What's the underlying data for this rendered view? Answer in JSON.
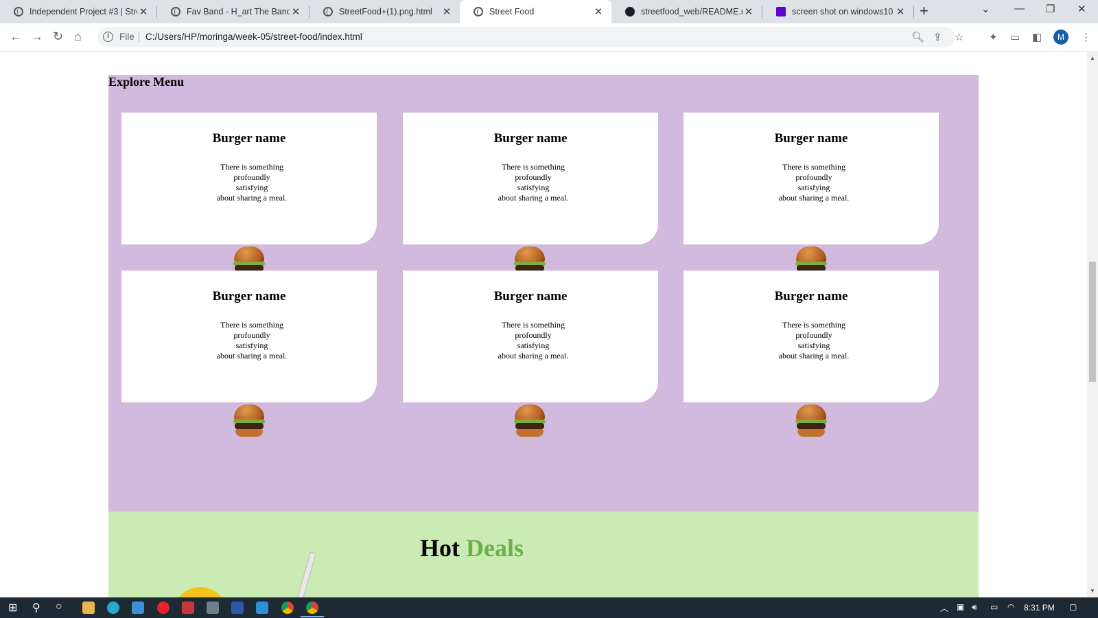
{
  "browser": {
    "tabs": [
      {
        "title": "Independent Project #3 | Stree",
        "active": false
      },
      {
        "title": "Fav Band - H_art The Band",
        "active": false
      },
      {
        "title": "StreetFood+(1).png.html",
        "active": false
      },
      {
        "title": "Street Food",
        "active": true
      },
      {
        "title": "streetfood_web/README.md",
        "active": false
      },
      {
        "title": "screen shot on windows10 - Y",
        "active": false
      }
    ],
    "new_tab_label": "+",
    "address": {
      "scheme_label": "File",
      "url": "C:/Users/HP/moringa/week-05/street-food/index.html"
    },
    "profile_initial": "M"
  },
  "page": {
    "menu": {
      "heading": "Explore Menu",
      "cards": [
        {
          "name": "Burger name",
          "description": "There is something\nprofoundly\nsatisfying\nabout sharing a meal."
        },
        {
          "name": "Burger name",
          "description": "There is something\nprofoundly\nsatisfying\nabout sharing a meal."
        },
        {
          "name": "Burger name",
          "description": "There is something\nprofoundly\nsatisfying\nabout sharing a meal."
        },
        {
          "name": "Burger name",
          "description": "There is something\nprofoundly\nsatisfying\nabout sharing a meal."
        },
        {
          "name": "Burger name",
          "description": "There is something\nprofoundly\nsatisfying\nabout sharing a meal."
        },
        {
          "name": "Burger name",
          "description": "There is something\nprofoundly\nsatisfying\nabout sharing a meal."
        }
      ]
    },
    "deals": {
      "title_main": "Hot",
      "title_accent": "Deals"
    }
  },
  "taskbar": {
    "clock": "8:31 PM"
  },
  "colors": {
    "menu_background": "#d2bade",
    "deals_background": "#caebb3",
    "deals_accent": "#6bb04a",
    "taskbar": "#1d2a33"
  }
}
